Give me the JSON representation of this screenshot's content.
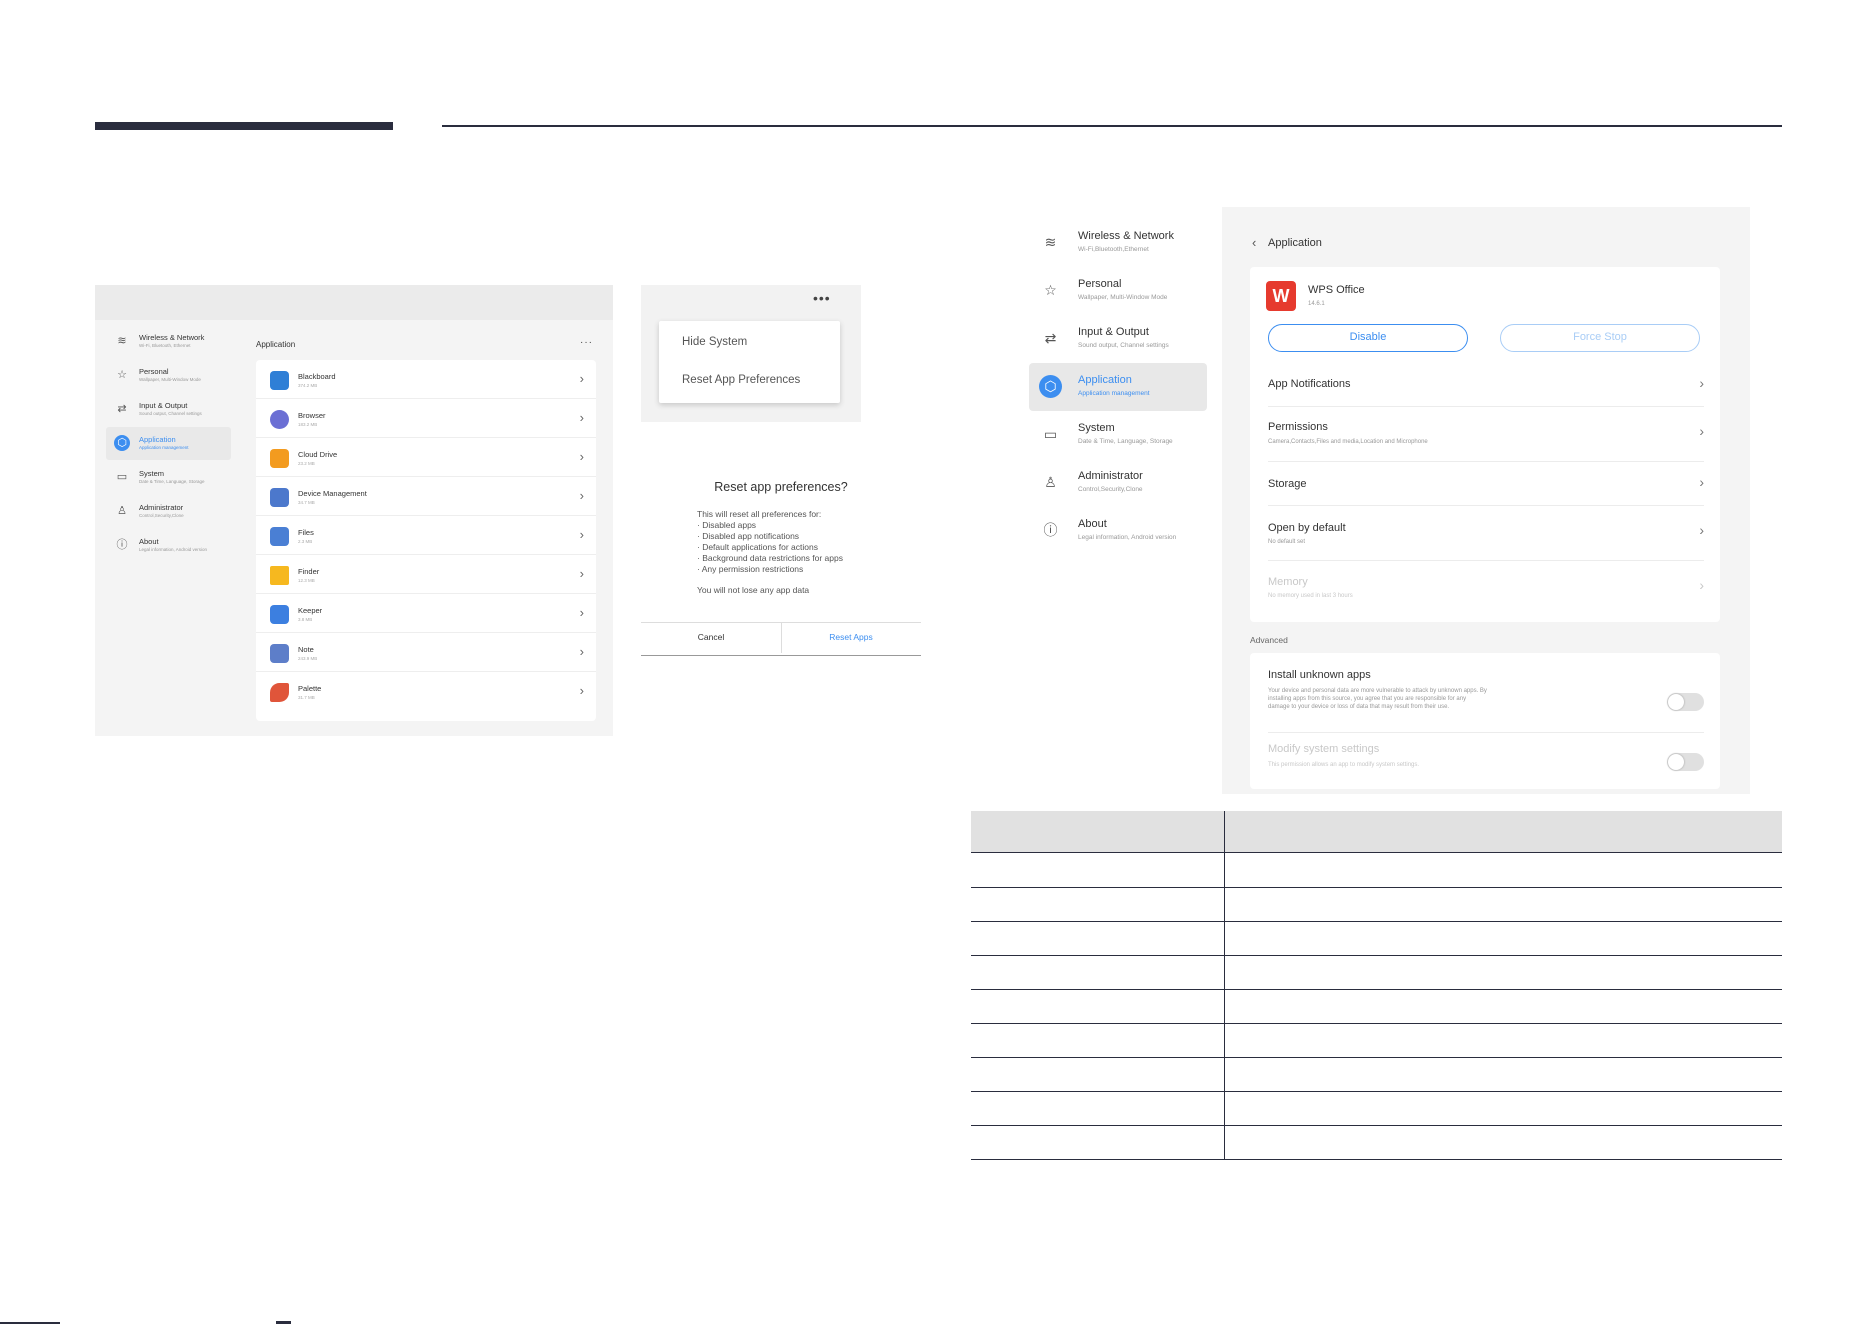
{
  "screen1": {
    "sidebar": [
      {
        "label": "Wireless & Network",
        "sub": "Wi-Fi, Bluetooth, Ethernet",
        "icon": "wifi-icon",
        "glyph": "≋"
      },
      {
        "label": "Personal",
        "sub": "Wallpaper, Multi-Window Mode",
        "icon": "star-icon",
        "glyph": "☆"
      },
      {
        "label": "Input & Output",
        "sub": "Sound output, Channel settings",
        "icon": "swap-icon",
        "glyph": "⇄"
      },
      {
        "label": "Application",
        "sub": "Application management",
        "icon": "app-cube-icon",
        "glyph": "⬡"
      },
      {
        "label": "System",
        "sub": "Date & Time, Language, Storage",
        "icon": "monitor-icon",
        "glyph": "▭"
      },
      {
        "label": "Administrator",
        "sub": "Control,Security,Clone",
        "icon": "person-icon",
        "glyph": "♙"
      },
      {
        "label": "About",
        "sub": "Legal information, Android version",
        "icon": "info-icon",
        "glyph": "ⓘ"
      }
    ],
    "title": "Application",
    "more": "···",
    "apps": [
      {
        "name": "Blackboard",
        "size": "374.2 MB",
        "color": "#2f7fd6"
      },
      {
        "name": "Browser",
        "size": "183.2 MB",
        "color": "#6b6fd4"
      },
      {
        "name": "Cloud Drive",
        "size": "23.2 MB",
        "color": "#f39b1f"
      },
      {
        "name": "Device Management",
        "size": "34.7 MB",
        "color": "#4c78cc"
      },
      {
        "name": "Files",
        "size": "2.3 MB",
        "color": "#4a7fd4"
      },
      {
        "name": "Finder",
        "size": "12.3 MB",
        "color": "#f6b81f"
      },
      {
        "name": "Keeper",
        "size": "3.8 MB",
        "color": "#3c7fe0"
      },
      {
        "name": "Note",
        "size": "243.9 MB",
        "color": "#5d7ec9"
      },
      {
        "name": "Palette",
        "size": "31.7 MB",
        "color": "#e0553a"
      }
    ]
  },
  "menu": {
    "dots": "•••",
    "items": [
      "Hide System",
      "Reset App Preferences"
    ]
  },
  "dialog": {
    "title": "Reset app preferences?",
    "lines": [
      "This will reset all preferences for:",
      "· Disabled apps",
      "· Disabled app notifications",
      "· Default applications for actions",
      "· Background data restrictions for apps",
      "· Any permission restrictions"
    ],
    "note": "You will not lose any app data",
    "cancel": "Cancel",
    "reset": "Reset Apps"
  },
  "screen4": {
    "sidebar": [
      {
        "label": "Wireless & Network",
        "sub": "Wi-Fi,Bluetooth,Ethernet",
        "icon": "wifi-icon",
        "glyph": "≋"
      },
      {
        "label": "Personal",
        "sub": "Wallpaper, Multi-Window Mode",
        "icon": "star-icon",
        "glyph": "☆"
      },
      {
        "label": "Input & Output",
        "sub": "Sound output, Channel settings",
        "icon": "swap-icon",
        "glyph": "⇄"
      },
      {
        "label": "Application",
        "sub": "Application management",
        "icon": "app-cube-icon",
        "glyph": "⬡"
      },
      {
        "label": "System",
        "sub": "Date & Time, Language, Storage",
        "icon": "monitor-icon",
        "glyph": "▭"
      },
      {
        "label": "Administrator",
        "sub": "Control,Security,Clone",
        "icon": "person-icon",
        "glyph": "♙"
      },
      {
        "label": "About",
        "sub": "Legal information, Android version",
        "icon": "info-icon",
        "glyph": "ⓘ"
      }
    ],
    "back_title": "Application",
    "app_name": "WPS Office",
    "app_version": "14.6.1",
    "disable": "Disable",
    "force_stop": "Force Stop",
    "rows": [
      {
        "title": "App Notifications",
        "sub": ""
      },
      {
        "title": "Permissions",
        "sub": "Camera,Contacts,Files and media,Location and Microphone"
      },
      {
        "title": "Storage",
        "sub": ""
      },
      {
        "title": "Open by default",
        "sub": "No default set"
      },
      {
        "title": "Memory",
        "sub": "No memory used in last 3 hours"
      }
    ],
    "advanced": "Advanced",
    "install_title": "Install unknown apps",
    "install_desc": "Your device and personal data are more vulnerable to attack by unknown apps. By installing apps from this source, you agree that you are responsible for any damage to your device or loss of data that may result from their use.",
    "modify_title": "Modify system settings",
    "modify_desc": "This permission allows an app to modify system settings."
  }
}
